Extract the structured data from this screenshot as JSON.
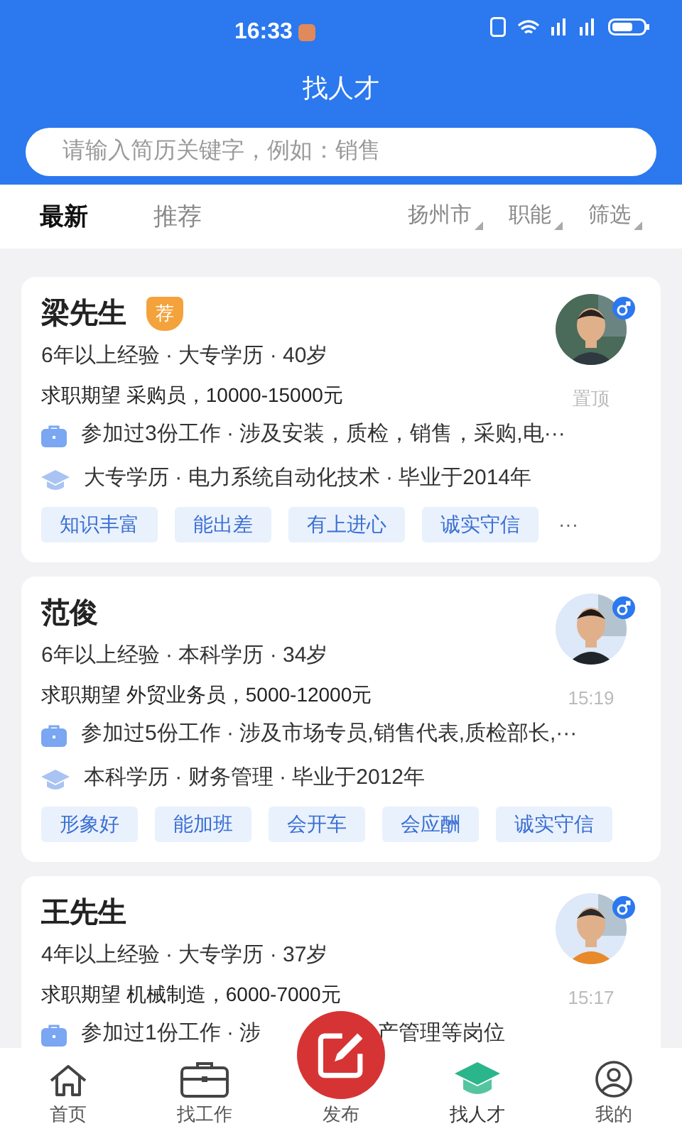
{
  "status_bar": {
    "time": "16:33"
  },
  "header": {
    "title": "找人才"
  },
  "search": {
    "placeholder": "请输入简历关键字，例如：销售"
  },
  "tabs": [
    {
      "label": "最新",
      "selected": true
    },
    {
      "label": "推荐",
      "selected": false
    }
  ],
  "filters": [
    {
      "label": "扬州市"
    },
    {
      "label": "职能"
    },
    {
      "label": "筛选"
    }
  ],
  "cards": [
    {
      "name": "梁先生",
      "recommended": true,
      "badge": "荐",
      "info": "6年以上经验 · 大专学历 · 40岁",
      "expect": "求职期望 采购员，10000-15000元",
      "note": "置顶",
      "work": "参加过3份工作 · 涉及安装，质检，销售，采购,电···",
      "edu": "大专学历 · 电力系统自动化技术 · 毕业于2014年",
      "tags": [
        "知识丰富",
        "能出差",
        "有上进心",
        "诚实守信"
      ],
      "more": "···"
    },
    {
      "name": "范俊",
      "recommended": false,
      "info": "6年以上经验 · 本科学历 · 34岁",
      "expect": "求职期望 外贸业务员，5000-12000元",
      "note": "15:19",
      "work": "参加过5份工作 · 涉及市场专员,销售代表,质检部长,···",
      "edu": "本科学历 · 财务管理 · 毕业于2012年",
      "tags": [
        "形象好",
        "能加班",
        "会开车",
        "会应酬",
        "诚实守信"
      ]
    },
    {
      "name": "王先生",
      "recommended": false,
      "info": "4年以上经验 · 大专学历 · 37岁",
      "expect": "求职期望 机械制造，6000-7000元",
      "note": "15:17",
      "work": "参加过1份工作 · 涉",
      "work_tail": "产管理等岗位"
    }
  ],
  "nav": [
    {
      "label": "首页",
      "kind": "home",
      "selected": false
    },
    {
      "label": "找工作",
      "kind": "jobs",
      "selected": false
    },
    {
      "label": "发布",
      "kind": "post",
      "selected": false
    },
    {
      "label": "找人才",
      "kind": "talent",
      "selected": true
    },
    {
      "label": "我的",
      "kind": "me",
      "selected": false
    }
  ]
}
